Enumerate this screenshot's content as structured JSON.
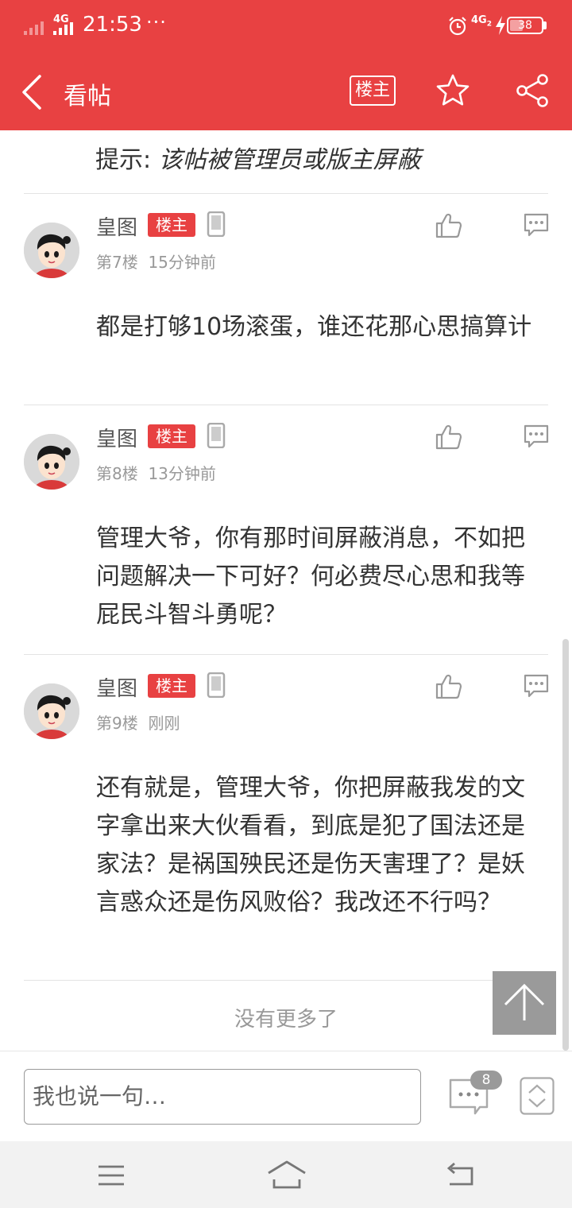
{
  "status_bar": {
    "network_left": "4G",
    "time": "21:53",
    "more": "···",
    "network_right": "4G",
    "network_right_sub": "2",
    "battery": "38"
  },
  "header": {
    "title": "看帖",
    "owner_button": "楼主",
    "icons": [
      "back-icon",
      "star-icon",
      "share-icon"
    ]
  },
  "notice": {
    "prefix": "提示: ",
    "text": "该帖被管理员或版主屏蔽"
  },
  "posts": [
    {
      "username": "皇图",
      "badge": "楼主",
      "floor": "第7楼",
      "time": "15分钟前",
      "body": "都是打够10场滚蛋，谁还花那心思搞算计"
    },
    {
      "username": "皇图",
      "badge": "楼主",
      "floor": "第8楼",
      "time": "13分钟前",
      "body": "管理大爷，你有那时间屏蔽消息，不如把问题解决一下可好？何必费尽心思和我等屁民斗智斗勇呢？"
    },
    {
      "username": "皇图",
      "badge": "楼主",
      "floor": "第9楼",
      "time": "刚刚",
      "body": "还有就是，管理大爷，你把屏蔽我发的文字拿出来大伙看看，到底是犯了国法还是家法？是祸国殃民还是伤天害理了？是妖言惑众还是伤风败俗？我改还不行吗？"
    }
  ],
  "footer": {
    "no_more": "没有更多了"
  },
  "input_bar": {
    "placeholder": "我也说一句…",
    "reply_count": "8"
  },
  "colors": {
    "brand_red": "#e84142",
    "muted_gray": "#999999"
  }
}
